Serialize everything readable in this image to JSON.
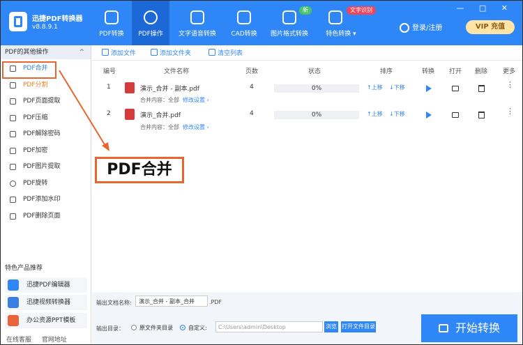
{
  "app": {
    "name": "迅捷PDF转换器",
    "version": "v8.8.9.1",
    "window_controls": "— □ ✕"
  },
  "nav": [
    {
      "label": "PDF转换",
      "icon": "swap-icon"
    },
    {
      "label": "PDF操作",
      "icon": "gear-icon",
      "active": true
    },
    {
      "label": "文字语音转换",
      "icon": "audio-wave-icon"
    },
    {
      "label": "CAD转换",
      "icon": "cad-icon"
    },
    {
      "label": "图片格式转换",
      "icon": "image-icon",
      "badge": "新"
    },
    {
      "label": "特色转换",
      "icon": "star-icon",
      "badge": "文字识别",
      "dropdown": "▾"
    }
  ],
  "account": {
    "login": "登录/注册",
    "vip": "VIP 充值"
  },
  "sidebar": {
    "header": "PDF的其他操作",
    "collapse": "^",
    "items": [
      "PDF合并",
      "PDF分割",
      "PDF页面提取",
      "PDF压缩",
      "PDF解除密码",
      "PDF加密",
      "PDF图片提取",
      "PDF旋转",
      "PDF添加水印",
      "PDF删除页面"
    ],
    "recommend_title": "特色产品推荐",
    "products": [
      "迅捷PDF编辑器",
      "迅捷视频转换器",
      "办公资源PPT模板"
    ],
    "footer": [
      "在线客服",
      "官网地址"
    ]
  },
  "toolbar": {
    "add_file": "添加文件",
    "add_folder": "添加文件夹",
    "clear": "清空列表"
  },
  "table": {
    "headers": [
      "编号",
      "文件名称",
      "页数",
      "状态",
      "排序",
      "转换",
      "打开",
      "删除",
      "更多"
    ],
    "rows": [
      {
        "no": "1",
        "name": "演示_合并 - 副本.pdf",
        "pages": "4",
        "status": "0%",
        "up": "↑上移",
        "down": "↓下移",
        "content": "合并内容：全部",
        "modify": "修改设置 ›"
      },
      {
        "no": "2",
        "name": "演示_合并.pdf",
        "pages": "4",
        "status": "0%",
        "up": "↑上移",
        "down": "↓下移",
        "content": "合并内容：全部",
        "modify": "修改设置 ›"
      }
    ],
    "more_glyph": "⋮"
  },
  "callout": "PDF合并",
  "bottom": {
    "output_name_label": "输出文档名称:",
    "output_name": "演示_合并 - 副本_合并",
    "ext": ".PDF",
    "dir_label": "输出目录：",
    "option_original": "原文件夹目录",
    "option_custom": "自定义:",
    "path": "C:\\Users\\admin\\Desktop",
    "browse": "浏览",
    "open_dir": "打开文件目录",
    "start": "开始转换"
  },
  "colors": {
    "brand": "#2f86f6",
    "highlight": "#e8652f",
    "split_item": "#e67e22"
  }
}
